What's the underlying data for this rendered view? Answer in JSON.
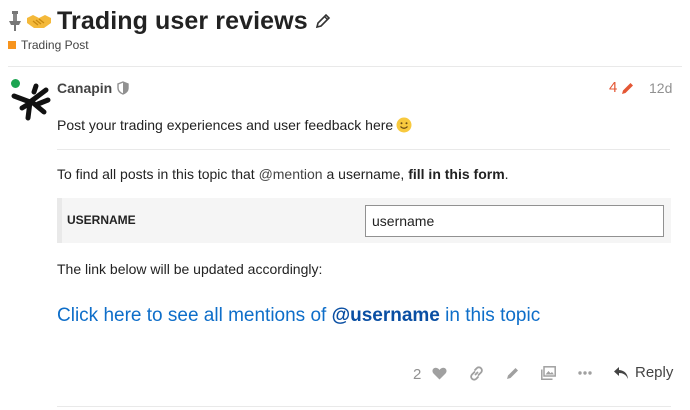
{
  "topic": {
    "title": "Trading user reviews",
    "category": "Trading Post",
    "category_color": "#f7941d",
    "icons": [
      "pin-icon",
      "handshake-icon",
      "pencil-icon"
    ]
  },
  "post": {
    "author": "Canapin",
    "author_status": "online",
    "edit_count": "4",
    "date": "12d",
    "intro": "Post your trading experiences and user feedback here",
    "find_prefix": "To find all posts in this topic that ",
    "find_mention": "@mention",
    "find_middle": " a username, ",
    "find_bold": "fill in this form",
    "find_suffix": ".",
    "form": {
      "label": "USERNAME",
      "value": "username"
    },
    "updated_text": "The link below will be updated accordingly:",
    "link": {
      "prefix": "Click here to see all mentions of ",
      "username": "@username",
      "suffix": " in this topic"
    },
    "controls": {
      "like_count": "2",
      "reply_label": "Reply"
    }
  },
  "colors": {
    "accent_link": "#0e6ec9",
    "edit_orange": "#e45735",
    "online_green": "#1ca551"
  }
}
